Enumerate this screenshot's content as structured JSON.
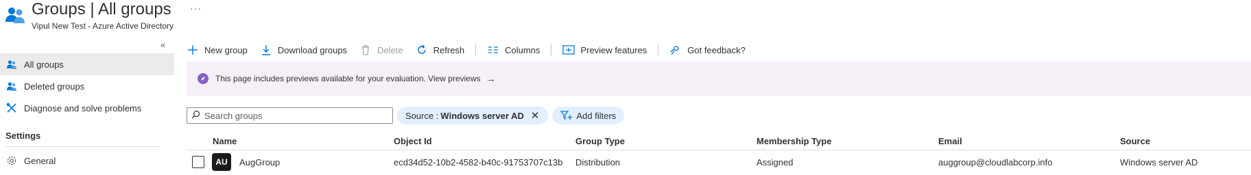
{
  "header": {
    "title": "Groups | All groups",
    "subtitle": "Vipul New Test - Azure Active Directory",
    "more_label": "···",
    "app_icon": "groups-icon"
  },
  "sidebar": {
    "collapse_label": "«",
    "items": [
      {
        "label": "All groups",
        "icon": "groups-icon",
        "active": true
      },
      {
        "label": "Deleted groups",
        "icon": "groups-icon",
        "active": false
      },
      {
        "label": "Diagnose and solve problems",
        "icon": "wrench-icon",
        "active": false
      }
    ],
    "section_settings": "Settings",
    "settings_items": [
      {
        "label": "General",
        "icon": "gear-icon"
      }
    ]
  },
  "toolbar": {
    "new_group": "New group",
    "download_groups": "Download groups",
    "delete": "Delete",
    "refresh": "Refresh",
    "columns": "Columns",
    "preview_features": "Preview features",
    "got_feedback": "Got feedback?"
  },
  "banner": {
    "text": "This page includes previews available for your evaluation. View previews",
    "arrow": "→"
  },
  "filters": {
    "search_placeholder": "Search groups",
    "source_pill_label": "Source :",
    "source_pill_value": "Windows server AD",
    "add_filters": "Add filters"
  },
  "table": {
    "columns": [
      "Name",
      "Object Id",
      "Group Type",
      "Membership Type",
      "Email",
      "Source"
    ],
    "rows": [
      {
        "avatar": "AU",
        "name": "AugGroup",
        "object_id": "ecd34d52-10b2-4582-b40c-91753707c13b",
        "group_type": "Distribution",
        "membership_type": "Assigned",
        "email": "auggroup@cloudlabcorp.info",
        "source": "Windows server AD"
      }
    ]
  },
  "colors": {
    "accent": "#0078d4",
    "banner_bg": "#f6eff8",
    "banner_icon": "#8661c5",
    "pill_bg": "#e1efff",
    "selected_nav": "#edebe9"
  }
}
